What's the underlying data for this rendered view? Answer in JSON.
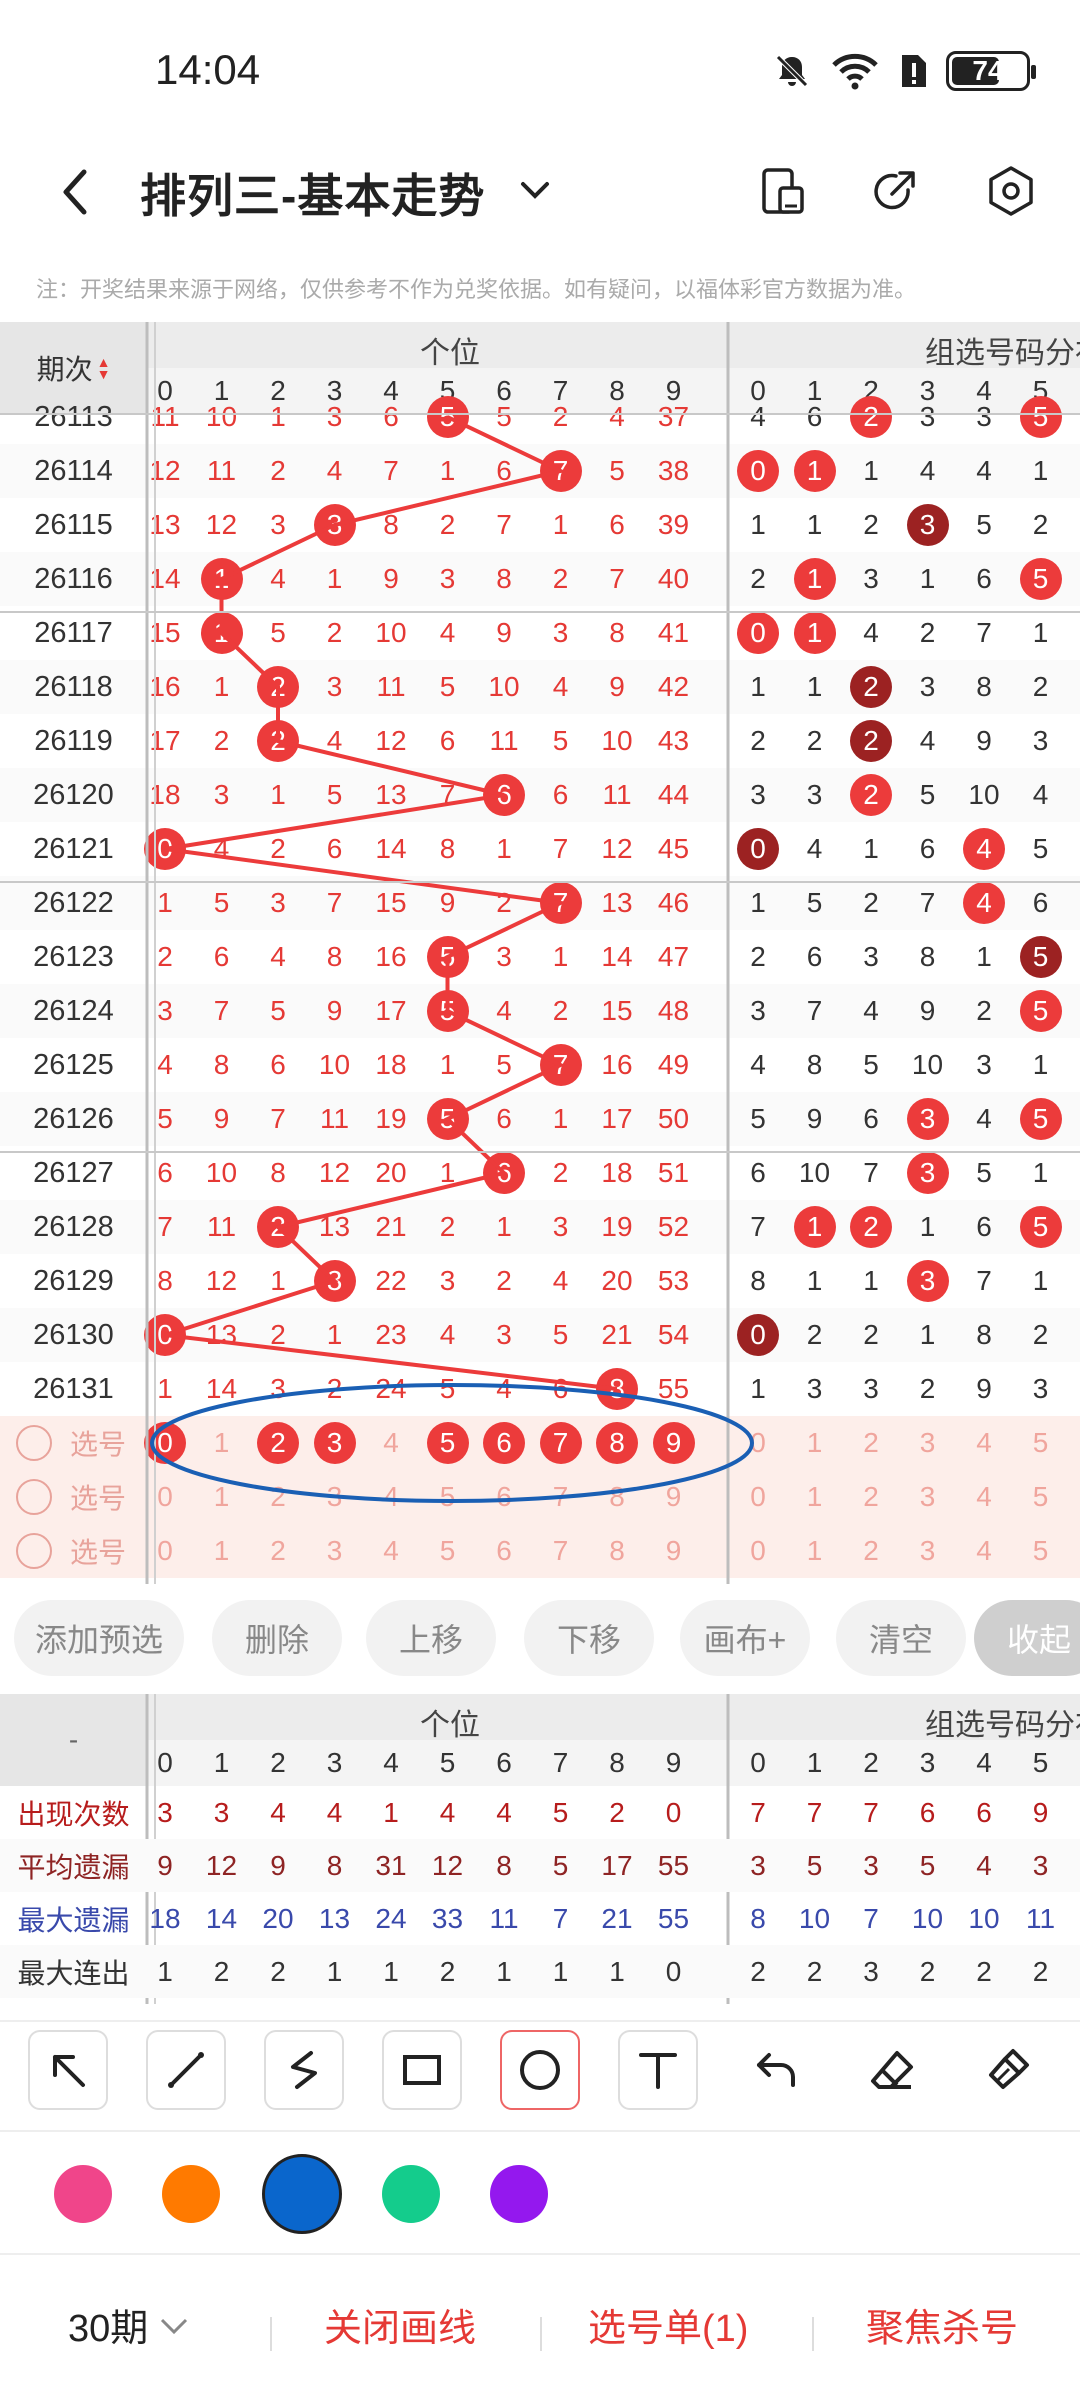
{
  "status": {
    "time": "14:04",
    "battery": "74"
  },
  "header": {
    "title": "排列三-基本走势"
  },
  "notice": "注：开奖结果来源于网络，仅供参考不作为兑奖依据。如有疑问，以福体彩官方数据为准。",
  "table": {
    "period_header": "期次",
    "group1_label": "个位",
    "group2_label": "组选号码分布",
    "digits": [
      "0",
      "1",
      "2",
      "3",
      "4",
      "5",
      "6",
      "7",
      "8",
      "9"
    ],
    "group2_digits": [
      "0",
      "1",
      "2",
      "3",
      "4",
      "5"
    ],
    "rows": [
      {
        "period": "26113",
        "g1": [
          "11",
          "10",
          "1",
          "3",
          "6",
          "B5",
          "5",
          "2",
          "4",
          "37"
        ],
        "g2": [
          "4",
          "6",
          "B2",
          "3",
          "3",
          "B5"
        ]
      },
      {
        "period": "26114",
        "g1": [
          "12",
          "11",
          "2",
          "4",
          "7",
          "1",
          "6",
          "B7",
          "5",
          "38"
        ],
        "g2": [
          "B0",
          "B1",
          "1",
          "4",
          "4",
          "1"
        ]
      },
      {
        "period": "26115",
        "g1": [
          "13",
          "12",
          "3",
          "B3",
          "8",
          "2",
          "7",
          "1",
          "6",
          "39"
        ],
        "g2": [
          "1",
          "1",
          "2",
          "D3",
          "5",
          "2"
        ]
      },
      {
        "period": "26116",
        "g1": [
          "14",
          "B1",
          "4",
          "1",
          "9",
          "3",
          "8",
          "2",
          "7",
          "40"
        ],
        "g2": [
          "2",
          "B1",
          "3",
          "1",
          "6",
          "B5"
        ]
      },
      {
        "period": "26117",
        "g1": [
          "15",
          "B1",
          "5",
          "2",
          "10",
          "4",
          "9",
          "3",
          "8",
          "41"
        ],
        "g2": [
          "B0",
          "B1",
          "4",
          "2",
          "7",
          "1"
        ]
      },
      {
        "period": "26118",
        "g1": [
          "16",
          "1",
          "B2",
          "3",
          "11",
          "5",
          "10",
          "4",
          "9",
          "42"
        ],
        "g2": [
          "1",
          "1",
          "D2",
          "3",
          "8",
          "2"
        ]
      },
      {
        "period": "26119",
        "g1": [
          "17",
          "2",
          "B2",
          "4",
          "12",
          "6",
          "11",
          "5",
          "10",
          "43"
        ],
        "g2": [
          "2",
          "2",
          "D2",
          "4",
          "9",
          "3"
        ]
      },
      {
        "period": "26120",
        "g1": [
          "18",
          "3",
          "1",
          "5",
          "13",
          "7",
          "B6",
          "6",
          "11",
          "44"
        ],
        "g2": [
          "3",
          "3",
          "B2",
          "5",
          "10",
          "4"
        ]
      },
      {
        "period": "26121",
        "g1": [
          "B0",
          "4",
          "2",
          "6",
          "14",
          "8",
          "1",
          "7",
          "12",
          "45"
        ],
        "g2": [
          "D0",
          "4",
          "1",
          "6",
          "B4",
          "5"
        ]
      },
      {
        "period": "26122",
        "g1": [
          "1",
          "5",
          "3",
          "7",
          "15",
          "9",
          "2",
          "B7",
          "13",
          "46"
        ],
        "g2": [
          "1",
          "5",
          "2",
          "7",
          "B4",
          "6"
        ]
      },
      {
        "period": "26123",
        "g1": [
          "2",
          "6",
          "4",
          "8",
          "16",
          "B5",
          "3",
          "1",
          "14",
          "47"
        ],
        "g2": [
          "2",
          "6",
          "3",
          "8",
          "1",
          "D5"
        ]
      },
      {
        "period": "26124",
        "g1": [
          "3",
          "7",
          "5",
          "9",
          "17",
          "B5",
          "4",
          "2",
          "15",
          "48"
        ],
        "g2": [
          "3",
          "7",
          "4",
          "9",
          "2",
          "B5"
        ]
      },
      {
        "period": "26125",
        "g1": [
          "4",
          "8",
          "6",
          "10",
          "18",
          "1",
          "5",
          "B7",
          "16",
          "49"
        ],
        "g2": [
          "4",
          "8",
          "5",
          "10",
          "3",
          "1"
        ]
      },
      {
        "period": "26126",
        "g1": [
          "5",
          "9",
          "7",
          "11",
          "19",
          "B5",
          "6",
          "1",
          "17",
          "50"
        ],
        "g2": [
          "5",
          "9",
          "6",
          "B3",
          "4",
          "B5"
        ]
      },
      {
        "period": "26127",
        "g1": [
          "6",
          "10",
          "8",
          "12",
          "20",
          "1",
          "B6",
          "2",
          "18",
          "51"
        ],
        "g2": [
          "6",
          "10",
          "7",
          "B3",
          "5",
          "1"
        ]
      },
      {
        "period": "26128",
        "g1": [
          "7",
          "11",
          "B2",
          "13",
          "21",
          "2",
          "1",
          "3",
          "19",
          "52"
        ],
        "g2": [
          "7",
          "B1",
          "B2",
          "1",
          "6",
          "B5"
        ]
      },
      {
        "period": "26129",
        "g1": [
          "8",
          "12",
          "1",
          "B3",
          "22",
          "3",
          "2",
          "4",
          "20",
          "53"
        ],
        "g2": [
          "8",
          "1",
          "1",
          "B3",
          "7",
          "1"
        ]
      },
      {
        "period": "26130",
        "g1": [
          "B0",
          "13",
          "2",
          "1",
          "23",
          "4",
          "3",
          "5",
          "21",
          "54"
        ],
        "g2": [
          "D0",
          "2",
          "2",
          "1",
          "8",
          "2"
        ]
      },
      {
        "period": "26131",
        "g1": [
          "1",
          "14",
          "3",
          "2",
          "24",
          "5",
          "4",
          "6",
          "B8",
          "55"
        ],
        "g2": [
          "1",
          "3",
          "3",
          "2",
          "9",
          "3"
        ]
      }
    ],
    "pick_label": "选号",
    "pick_rows": [
      {
        "selected": [
          "0",
          "2",
          "3",
          "5",
          "6",
          "7",
          "8",
          "9"
        ]
      },
      {
        "selected": []
      },
      {
        "selected": []
      }
    ]
  },
  "actions": [
    "添加预选",
    "删除",
    "上移",
    "下移",
    "画布+",
    "清空",
    "收起"
  ],
  "stats": {
    "group1_label": "个位",
    "group2_label": "组选号码分布",
    "header_dash": "-",
    "rows": [
      {
        "label": "出现次数",
        "color": "#b71c1c",
        "g1": [
          "3",
          "3",
          "4",
          "4",
          "1",
          "4",
          "4",
          "5",
          "2",
          "0"
        ],
        "g2": [
          "7",
          "7",
          "7",
          "6",
          "6",
          "9"
        ]
      },
      {
        "label": "平均遗漏",
        "color": "#8e2424",
        "g1": [
          "9",
          "12",
          "9",
          "8",
          "31",
          "12",
          "8",
          "5",
          "17",
          "55"
        ],
        "g2": [
          "3",
          "5",
          "3",
          "5",
          "4",
          "3"
        ]
      },
      {
        "label": "最大遗漏",
        "color": "#3949ab",
        "g1": [
          "18",
          "14",
          "20",
          "13",
          "24",
          "33",
          "11",
          "7",
          "21",
          "55"
        ],
        "g2": [
          "8",
          "10",
          "7",
          "10",
          "10",
          "11"
        ]
      },
      {
        "label": "最大连出",
        "color": "#333333",
        "g1": [
          "1",
          "2",
          "2",
          "1",
          "1",
          "2",
          "1",
          "1",
          "1",
          "0"
        ],
        "g2": [
          "2",
          "2",
          "3",
          "2",
          "2",
          "2"
        ]
      }
    ]
  },
  "palette": [
    "#f0458a",
    "#ff7a00",
    "#0a66cc",
    "#14cc8c",
    "#9418ee"
  ],
  "bottom": {
    "period_select": "30期",
    "close_draw": "关闭画线",
    "pick_list": "选号单(1)",
    "focus_kill": "聚焦杀号"
  }
}
